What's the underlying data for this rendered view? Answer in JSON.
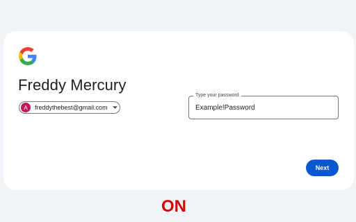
{
  "signin": {
    "display_name": "Freddy Mercury",
    "account": {
      "avatar_letter": "A",
      "email": "freddythebest@gmail.com"
    },
    "password_field": {
      "label": "Type your password",
      "value": "Example!Password"
    },
    "next_label": "Next"
  },
  "status_text": "ON",
  "colors": {
    "page_background": "#f0f4f9",
    "card_background": "#ffffff",
    "primary_button": "#0b57d0",
    "avatar": "#c2185b",
    "status_text": "#d50000"
  },
  "icons": {
    "logo": "google-logo-icon",
    "account_caret": "caret-down-icon"
  }
}
